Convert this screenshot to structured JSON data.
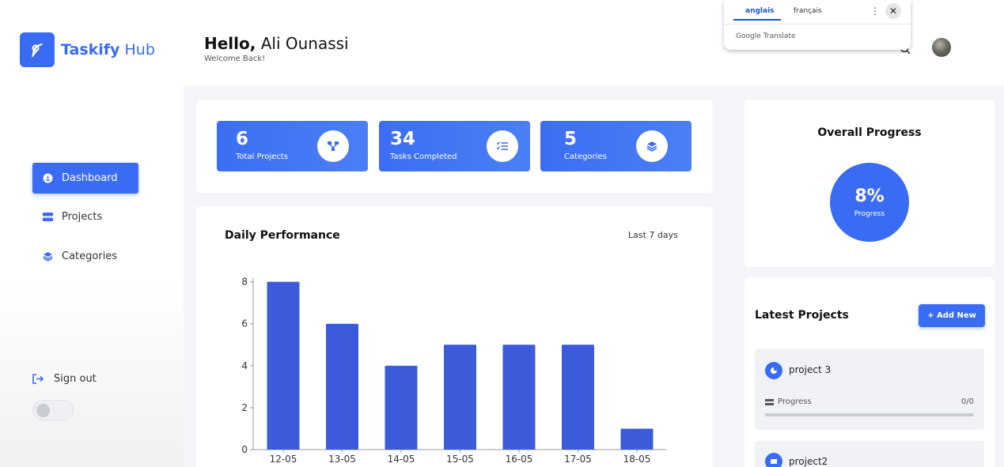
{
  "sidebar": {
    "logo_bold": "Taskify",
    "logo_light": "Hub",
    "items": [
      {
        "label": "Dashboard",
        "icon": "dashboard-icon",
        "active": true
      },
      {
        "label": "Projects",
        "icon": "projects-icon",
        "active": false
      },
      {
        "label": "Categories",
        "icon": "layers-icon",
        "active": false
      }
    ],
    "signout_label": "Sign out"
  },
  "header": {
    "greeting": "Hello,",
    "user_name": "Ali Ounassi",
    "welcome": "Welcome Back!"
  },
  "translate_popup": {
    "tab_source": "anglais",
    "tab_target": "français",
    "menu_glyph": "⋮",
    "close_glyph": "✕",
    "brand": "Google Translate"
  },
  "stats": [
    {
      "value": "6",
      "label": "Total Projects",
      "icon": "share-nodes-icon"
    },
    {
      "value": "34",
      "label": "Tasks Completed",
      "icon": "checklist-icon"
    },
    {
      "value": "5",
      "label": "Categories",
      "icon": "layers-icon"
    }
  ],
  "performance": {
    "title": "Daily Performance",
    "range": "Last 7 days"
  },
  "chart_data": {
    "type": "bar",
    "categories": [
      "12-05",
      "13-05",
      "14-05",
      "15-05",
      "16-05",
      "17-05",
      "18-05"
    ],
    "values": [
      8,
      6,
      4,
      5,
      5,
      5,
      1
    ],
    "yticks": [
      0,
      2,
      4,
      6,
      8
    ],
    "ylim": [
      0,
      8.1
    ],
    "color": "#3b5bdb",
    "title": "",
    "xlabel": "",
    "ylabel": ""
  },
  "overall_progress": {
    "title": "Overall Progress",
    "value": "8%",
    "label": "Progress"
  },
  "latest_projects": {
    "title": "Latest Projects",
    "add_button": "+ Add New",
    "projects": [
      {
        "name": "project 3",
        "progress_label": "Progress",
        "progress_value": "0/0"
      },
      {
        "name": "project2"
      }
    ]
  },
  "colors": {
    "accent": "#3a6cf3",
    "bar": "#3b5bdb"
  }
}
